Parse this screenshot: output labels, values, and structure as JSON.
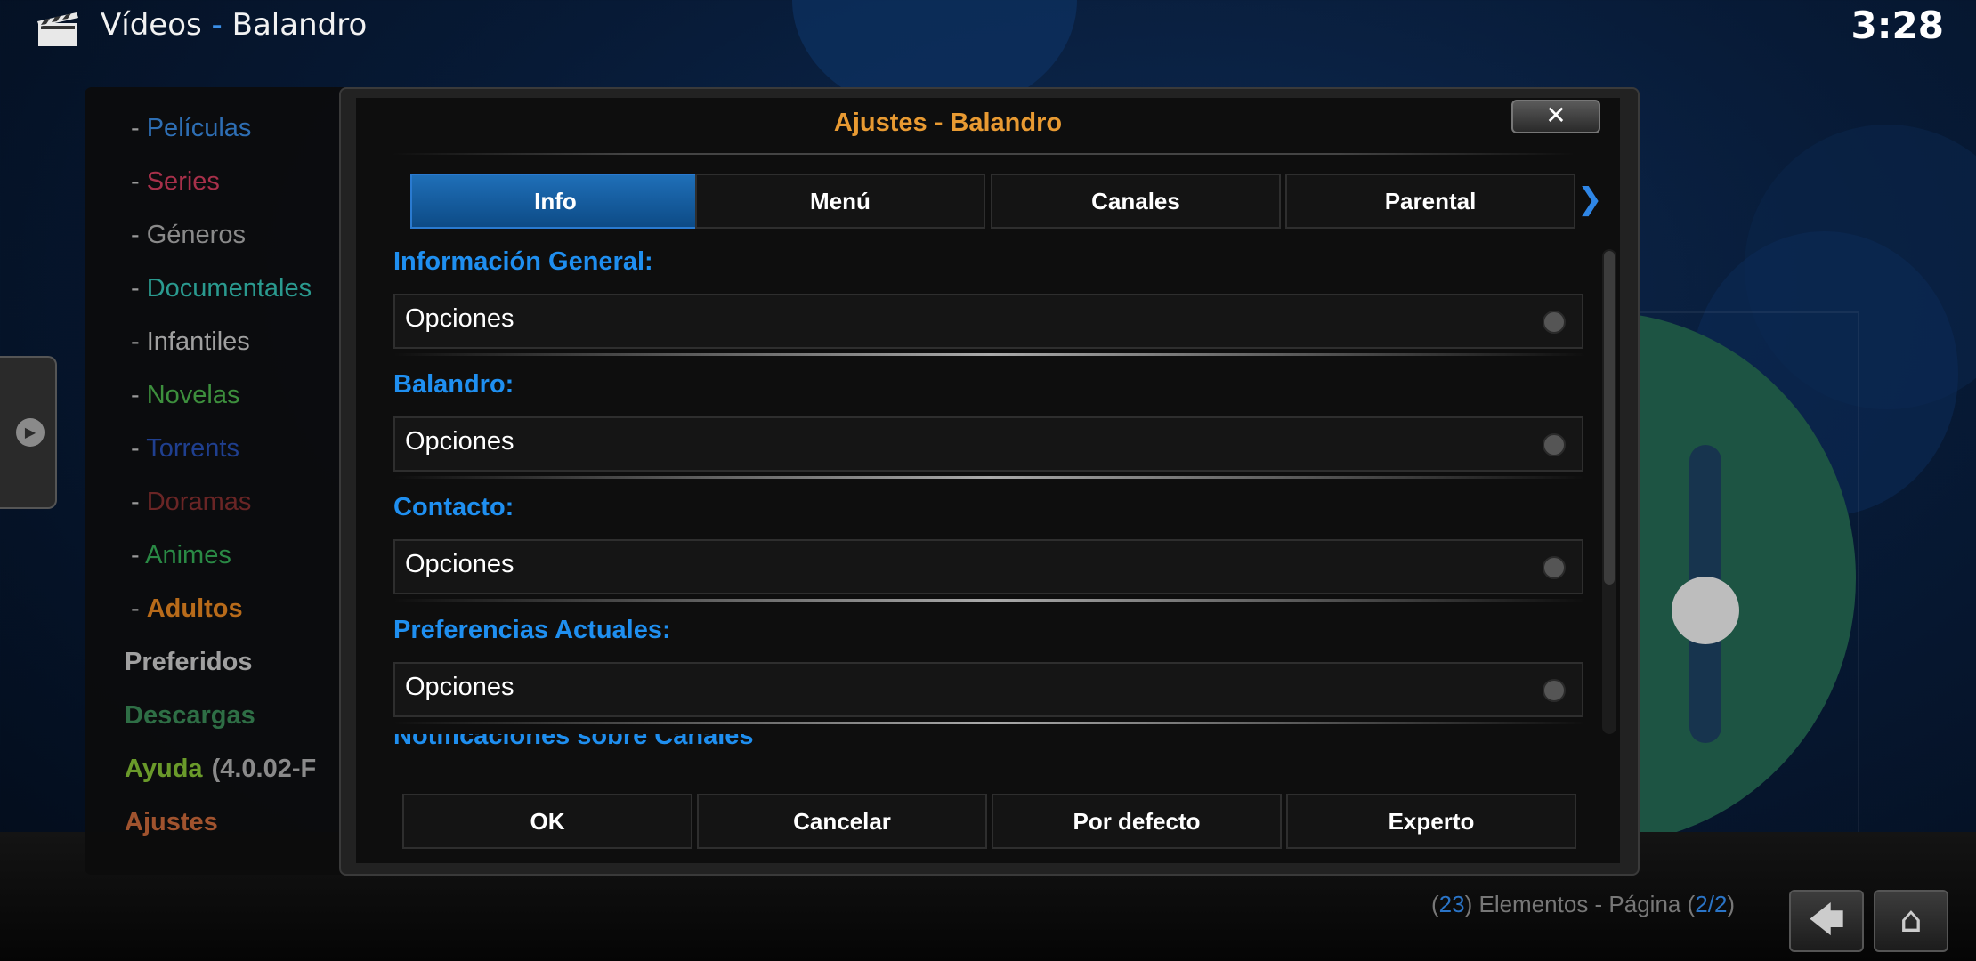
{
  "header": {
    "section": "Vídeos",
    "separator": "-",
    "addon": "Balandro",
    "clock": "3:28"
  },
  "menu": {
    "items": [
      {
        "label": "Películas",
        "color": "#2e6fb5",
        "dash": true
      },
      {
        "label": "Series",
        "color": "#a8304a",
        "dash": true
      },
      {
        "label": "Géneros",
        "color": "#8a8a8a",
        "dash": true
      },
      {
        "label": "Documentales",
        "color": "#2a9a8f",
        "dash": true
      },
      {
        "label": "Infantiles",
        "color": "#a0a0a0",
        "dash": true
      },
      {
        "label": "Novelas",
        "color": "#3d8f3d",
        "dash": true
      },
      {
        "label": "Torrents",
        "color": "#1f3f8f",
        "dash": true
      },
      {
        "label": "Doramas",
        "color": "#6a2525",
        "dash": true
      },
      {
        "label": "Animes",
        "color": "#2a8a45",
        "dash": true
      },
      {
        "label": "Adultos",
        "color": "#b86b1a",
        "dash": true,
        "bold": true
      },
      {
        "label": "Preferidos",
        "color": "#a0a0a0",
        "bold": true
      },
      {
        "label": "Descargas",
        "color": "#2e6e45",
        "bold": true
      },
      {
        "label": "Ayuda",
        "color": "#6a9a2a",
        "bold": true,
        "suffix": "(4.0.02-F",
        "suffix_color": "#8a8a8a"
      },
      {
        "label": "Ajustes",
        "color": "#a0532e",
        "bold": true
      }
    ]
  },
  "dialog": {
    "title": "Ajustes - Balandro",
    "close_glyph": "✕",
    "tabs": [
      "Info",
      "Menú",
      "Canales",
      "Parental"
    ],
    "next_glyph": "❯",
    "sections": [
      {
        "title": "Información General:",
        "option": "Opciones"
      },
      {
        "title": "Balandro:",
        "option": "Opciones"
      },
      {
        "title": "Contacto:",
        "option": "Opciones"
      },
      {
        "title": "Preferencias Actuales:",
        "option": "Opciones"
      }
    ],
    "partial_section": "Notificaciones sobre Canales",
    "buttons": {
      "ok": "OK",
      "cancel": "Cancelar",
      "default": "Por defecto",
      "expert": "Experto"
    }
  },
  "status": {
    "open_paren": "(",
    "count": "23",
    "mid": ") Elementos - Página (",
    "page": "2/2",
    "close_paren": ")"
  },
  "nav": {
    "back_glyph": "🡄",
    "home_glyph": "⌂"
  }
}
